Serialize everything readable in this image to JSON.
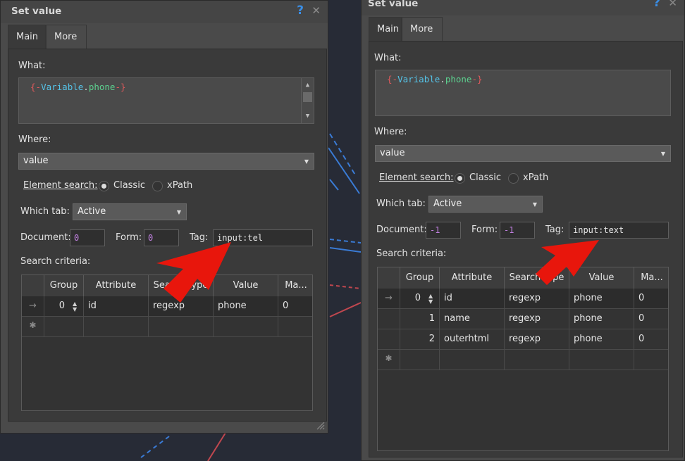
{
  "left_dialog": {
    "title": "Set value",
    "help_glyph": "?",
    "close_glyph": "✕",
    "tabs": [
      {
        "label": "Main"
      },
      {
        "label": "More"
      }
    ],
    "what_label": "What:",
    "what_value": {
      "open": "{-",
      "var": "Variable",
      "dot": ".",
      "name": "phone",
      "close": "-}"
    },
    "where_label": "Where:",
    "where_value": "value",
    "element_search_label": "Element search:",
    "classic_label": "Classic",
    "xpath_label": "xPath",
    "which_tab_label": "Which tab:",
    "which_tab_value": "Active",
    "document_label": "Document:",
    "document_value": "0",
    "form_label": "Form:",
    "form_value": "0",
    "tag_label": "Tag:",
    "tag_value": "input:tel",
    "criteria_label": "Search criteria:",
    "columns": [
      "Group",
      "Attribute",
      "Search type",
      "Value",
      "Ma..."
    ],
    "rows": [
      {
        "group": "0",
        "attribute": "id",
        "search_type": "regexp",
        "value": "phone",
        "match": "0"
      }
    ],
    "row_indicator": "→",
    "new_row_indicator": "✱"
  },
  "right_dialog": {
    "title": "Set value",
    "help_glyph": "?",
    "close_glyph": "✕",
    "tabs": [
      {
        "label": "Main"
      },
      {
        "label": "More"
      }
    ],
    "what_label": "What:",
    "what_value": {
      "open": "{-",
      "var": "Variable",
      "dot": ".",
      "name": "phone",
      "close": "-}"
    },
    "where_label": "Where:",
    "where_value": "value",
    "element_search_label": "Element search:",
    "classic_label": "Classic",
    "xpath_label": "xPath",
    "which_tab_label": "Which tab:",
    "which_tab_value": "Active",
    "document_label": "Document:",
    "document_value": "-1",
    "form_label": "Form:",
    "form_value": "-1",
    "tag_label": "Tag:",
    "tag_value": "input:text",
    "criteria_label": "Search criteria:",
    "columns": [
      "Group",
      "Attribute",
      "Search type",
      "Value",
      "Ma..."
    ],
    "rows": [
      {
        "group": "0",
        "attribute": "id",
        "search_type": "regexp",
        "value": "phone",
        "match": "0"
      },
      {
        "group": "1",
        "attribute": "name",
        "search_type": "regexp",
        "value": "phone",
        "match": "0"
      },
      {
        "group": "2",
        "attribute": "outerhtml",
        "search_type": "regexp",
        "value": "phone",
        "match": "0"
      }
    ],
    "row_indicator": "→",
    "new_row_indicator": "✱"
  },
  "colors": {
    "accent_help": "#3a8ee6",
    "arrow": "#e8160c",
    "token_brace": "#e0595b",
    "token_variable": "#55c3e8",
    "token_name": "#5cd08f"
  }
}
